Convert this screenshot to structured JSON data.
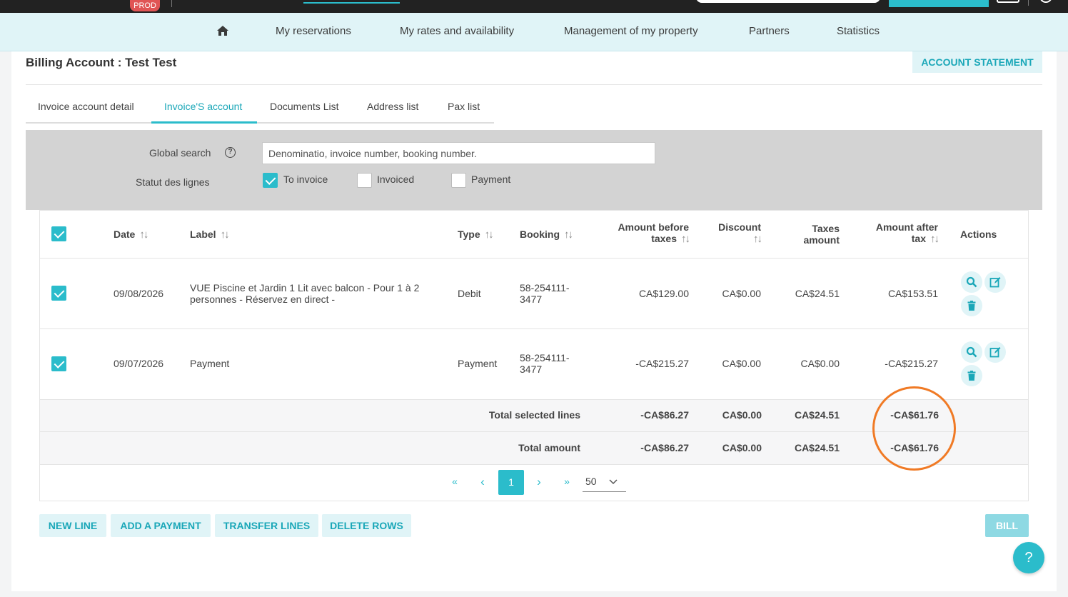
{
  "topbar": {
    "env_badge": "PROD"
  },
  "nav": {
    "items": [
      "My reservations",
      "My rates and availability",
      "Management of my property",
      "Partners",
      "Statistics"
    ]
  },
  "page": {
    "title": "Billing Account : Test Test",
    "statement_button": "ACCOUNT STATEMENT"
  },
  "tabs": [
    "Invoice account detail",
    "Invoice'S account",
    "Documents List",
    "Address list",
    "Pax list"
  ],
  "active_tab": "Invoice'S account",
  "filters": {
    "search_label": "Global search",
    "search_placeholder": "Denominatio, invoice number, booking number.",
    "status_label": "Statut des lignes",
    "statuses": [
      {
        "label": "To invoice",
        "checked": true
      },
      {
        "label": "Invoiced",
        "checked": false
      },
      {
        "label": "Payment",
        "checked": false
      }
    ]
  },
  "table": {
    "headers": {
      "date": "Date",
      "label": "Label",
      "type": "Type",
      "booking": "Booking",
      "amount_before_1": "Amount before",
      "amount_before_2": "taxes",
      "discount": "Discount",
      "taxes_1": "Taxes",
      "taxes_2": "amount",
      "amount_after_1": "Amount after",
      "amount_after_2": "tax",
      "actions": "Actions"
    },
    "rows": [
      {
        "checked": true,
        "date": "09/08/2026",
        "label_1": "VUE Piscine et Jardin 1 Lit avec balcon - Pour 1 à 2",
        "label_2": "personnes - Réservez en direct -",
        "type": "Debit",
        "booking_1": "58-254111-",
        "booking_2": "3477",
        "amount_before": "CA$129.00",
        "discount": "CA$0.00",
        "taxes": "CA$24.51",
        "amount_after": "CA$153.51"
      },
      {
        "checked": true,
        "date": "09/07/2026",
        "label_1": "Payment",
        "label_2": "",
        "type": "Payment",
        "booking_1": "58-254111-",
        "booking_2": "3477",
        "amount_before": "-CA$215.27",
        "discount": "CA$0.00",
        "taxes": "CA$0.00",
        "amount_after": "-CA$215.27"
      }
    ],
    "totals": [
      {
        "label": "Total selected lines",
        "amount_before": "-CA$86.27",
        "discount": "CA$0.00",
        "taxes": "CA$24.51",
        "amount_after": "-CA$61.76"
      },
      {
        "label": "Total amount",
        "amount_before": "-CA$86.27",
        "discount": "CA$0.00",
        "taxes": "CA$24.51",
        "amount_after": "-CA$61.76"
      }
    ]
  },
  "pagination": {
    "first": "«",
    "prev": "‹",
    "current": "1",
    "next": "›",
    "last": "»",
    "page_size": "50"
  },
  "buttons": {
    "new_line": "NEW LINE",
    "add_payment": "ADD A PAYMENT",
    "transfer": "TRANSFER LINES",
    "delete": "DELETE ROWS",
    "bill": "BILL",
    "help": "?"
  },
  "colors": {
    "accent": "#2bbccb",
    "accent_light": "#e0f4f7",
    "highlight": "#f07a25"
  }
}
